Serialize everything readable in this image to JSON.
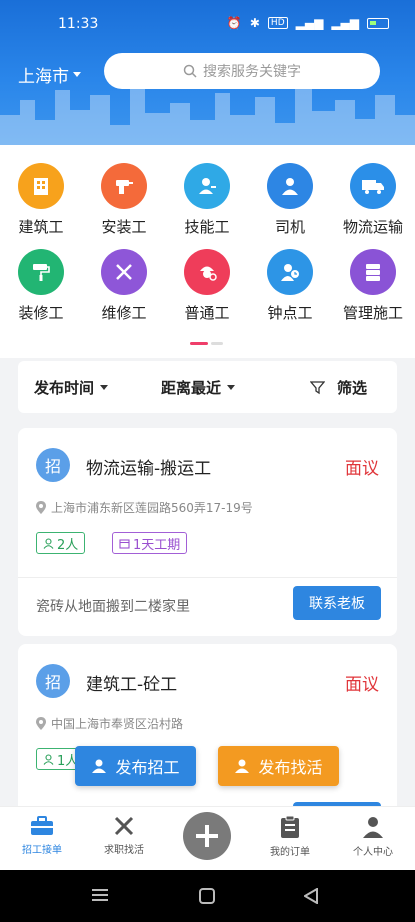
{
  "status_bar": {
    "time": "11:33",
    "icons": [
      "alarm-icon",
      "bluetooth-icon",
      "hd-icon",
      "signal-icon",
      "signal-icon",
      "battery-icon"
    ],
    "hd_label": "HD"
  },
  "header": {
    "city": "上海市",
    "search_placeholder": "搜索服务关键字"
  },
  "categories": [
    {
      "label": "建筑工",
      "icon": "building-icon",
      "color": "#f7a21c"
    },
    {
      "label": "安装工",
      "icon": "drill-icon",
      "color": "#f46a3a"
    },
    {
      "label": "技能工",
      "icon": "worker-icon",
      "color": "#2fa9e6"
    },
    {
      "label": "司机",
      "icon": "driver-icon",
      "color": "#2d86e4"
    },
    {
      "label": "物流运输",
      "icon": "truck-icon",
      "color": "#2b8fe8"
    },
    {
      "label": "装修工",
      "icon": "paint-roller-icon",
      "color": "#22b573"
    },
    {
      "label": "维修工",
      "icon": "tools-icon",
      "color": "#8e56d8"
    },
    {
      "label": "普通工",
      "icon": "helmet-worker-icon",
      "color": "#ef3d5a"
    },
    {
      "label": "钟点工",
      "icon": "clock-worker-icon",
      "color": "#2d95e6"
    },
    {
      "label": "管理施工",
      "icon": "cabinet-icon",
      "color": "#8a53d6"
    }
  ],
  "filters": {
    "publish_time": "发布时间",
    "distance": "距离最近",
    "filter": "筛选"
  },
  "jobs": [
    {
      "badge": "招",
      "title": "物流运输-搬运工",
      "salary": "面议",
      "address": "上海市浦东新区莲园路560弄17-19号",
      "people": "2人",
      "duration": "1天工期",
      "description": "瓷砖从地面搬到二楼家里",
      "contact_label": "联系老板"
    },
    {
      "badge": "招",
      "title": "建筑工-砼工",
      "salary": "面议",
      "address": "中国上海市奉贤区沿村路",
      "people": "1人",
      "duration": "",
      "description": "",
      "contact_label": ""
    }
  ],
  "fabs": {
    "post_job": "发布招工",
    "find_job": "发布找活"
  },
  "bottom_nav": [
    {
      "label": "招工接单",
      "icon": "briefcase-icon",
      "active": true
    },
    {
      "label": "求职找活",
      "icon": "tools-icon",
      "active": false
    },
    {
      "label": "",
      "icon": "plus-icon",
      "active": false
    },
    {
      "label": "我的订单",
      "icon": "clipboard-icon",
      "active": false
    },
    {
      "label": "个人中心",
      "icon": "person-icon",
      "active": false
    }
  ],
  "colors": {
    "primary": "#2e86e0",
    "accent_orange": "#f39a21",
    "salary_red": "#e0353a",
    "indicator_pink": "#ef3e6a"
  }
}
